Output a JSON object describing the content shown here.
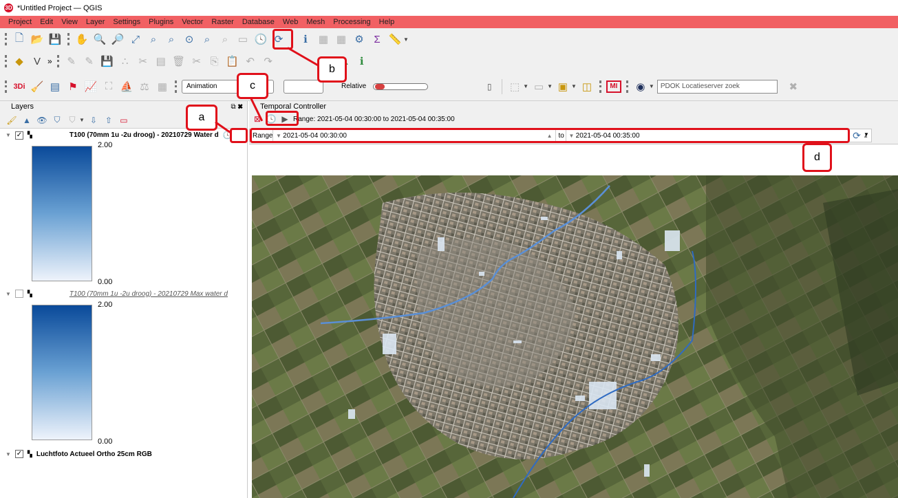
{
  "window": {
    "title": "*Untitled Project — QGIS",
    "logo": "3D"
  },
  "menu": [
    "Project",
    "Edit",
    "View",
    "Layer",
    "Settings",
    "Plugins",
    "Vector",
    "Raster",
    "Database",
    "Web",
    "Mesh",
    "Processing",
    "Help"
  ],
  "toolbar3": {
    "animation_label": "Animation",
    "relative_label": "Relative",
    "search_placeholder": "PDOK Locatieserver zoek",
    "mi_label": "MI"
  },
  "layers_panel": {
    "title": "Layers",
    "items": [
      {
        "label": "T100 (70mm 1u -2u droog) - 20210729 Water d",
        "checked": "✓",
        "max": "2.00",
        "min": "0.00"
      },
      {
        "label": "T100 (70mm 1u -2u droog) - 20210729 Max water d",
        "checked": "",
        "max": "2.00",
        "min": "0.00"
      },
      {
        "label": "Luchtfoto Actueel Ortho 25cm RGB",
        "checked": "✓"
      }
    ]
  },
  "temporal": {
    "title": "Temporal Controller",
    "range_text": "Range: 2021-05-04 00:30:00 to 2021-05-04 00:35:00",
    "mode": "Range",
    "from": "2021-05-04 00:30:00",
    "to_label": "to",
    "to": "2021-05-04 00:35:00"
  },
  "annotations": {
    "a": "a",
    "b": "b",
    "c": "c",
    "d": "d"
  },
  "colors": {
    "menubar": "#f16063",
    "annotation": "#e0101a"
  }
}
